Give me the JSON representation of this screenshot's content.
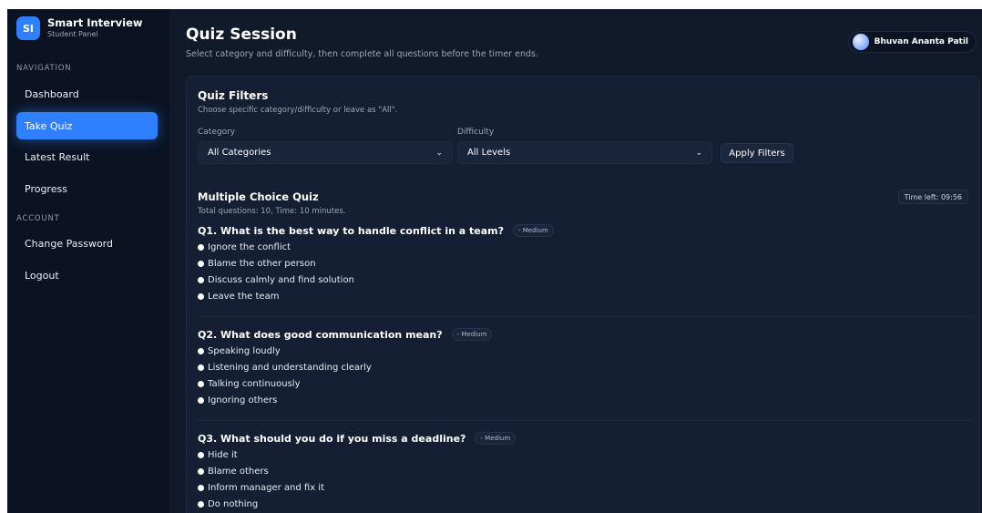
{
  "brand": {
    "logo": "SI",
    "title": "Smart Interview",
    "subtitle": "Student Panel"
  },
  "sidebar": {
    "nav_heading": "NAVIGATION",
    "nav_items": [
      {
        "label": "Dashboard",
        "active": false
      },
      {
        "label": "Take Quiz",
        "active": true
      },
      {
        "label": "Latest Result",
        "active": false
      },
      {
        "label": "Progress",
        "active": false
      }
    ],
    "account_heading": "ACCOUNT",
    "account_items": [
      {
        "label": "Change Password"
      },
      {
        "label": "Logout"
      }
    ]
  },
  "header": {
    "title": "Quiz Session",
    "subtitle": "Select category and difficulty, then complete all questions before the timer ends.",
    "user_name": "Bhuvan Ananta Patil"
  },
  "filters": {
    "title": "Quiz Filters",
    "subtitle": "Choose specific category/difficulty or leave as \"All\".",
    "category_label": "Category",
    "category_value": "All Categories",
    "difficulty_label": "Difficulty",
    "difficulty_value": "All Levels",
    "apply_label": "Apply Filters"
  },
  "quiz": {
    "title": "Multiple Choice Quiz",
    "subtitle": "Total questions: 10, Time: 10 minutes.",
    "timer": "Time left: 09:56",
    "questions": [
      {
        "text": "Q1. What is the best way to handle conflict in a team?",
        "difficulty": "- Medium",
        "options": [
          "Ignore the conflict",
          "Blame the other person",
          "Discuss calmly and find solution",
          "Leave the team"
        ]
      },
      {
        "text": "Q2. What does good communication mean?",
        "difficulty": "- Medium",
        "options": [
          "Speaking loudly",
          "Listening and understanding clearly",
          "Talking continuously",
          "Ignoring others"
        ]
      },
      {
        "text": "Q3. What should you do if you miss a deadline?",
        "difficulty": "- Medium",
        "options": [
          "Hide it",
          "Blame others",
          "Inform manager and fix it",
          "Do nothing"
        ]
      }
    ]
  },
  "colors": {
    "accent": "#2f80ff",
    "background": "#111a2b",
    "sidebar": "#0b1322"
  }
}
